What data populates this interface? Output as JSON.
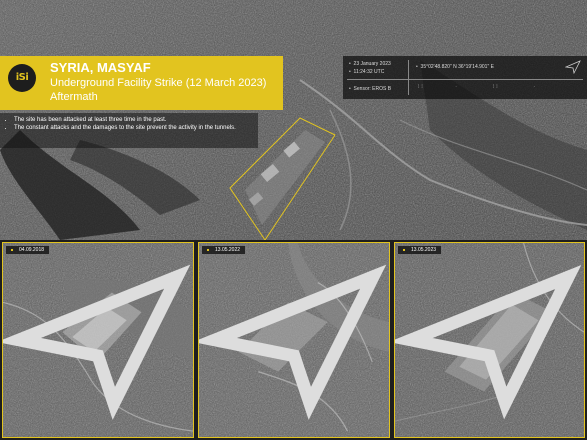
{
  "logo": {
    "text": "iSi"
  },
  "header": {
    "title": "SYRIA, MASYAF",
    "subtitle_line1": "Underground Facility Strike (12 March 2023)",
    "subtitle_line2": "Aftermath"
  },
  "notes": [
    "The site has been attacked at least three time in the past.",
    "The constant attacks and the damages to the site prevent the activity in the tunnels."
  ],
  "info": {
    "date": "23 January 2023",
    "time": "11:24:32 UTC",
    "coordinates": "35°02'48.820\" N  36°19'14.901\" E",
    "sensor": "Sensor: EROS B"
  },
  "insets": [
    {
      "date": "04.09.2018"
    },
    {
      "date": "13.05.2022"
    },
    {
      "date": "13.05.2023"
    }
  ],
  "colors": {
    "accent": "#e2c41f",
    "panel": "#141414"
  }
}
